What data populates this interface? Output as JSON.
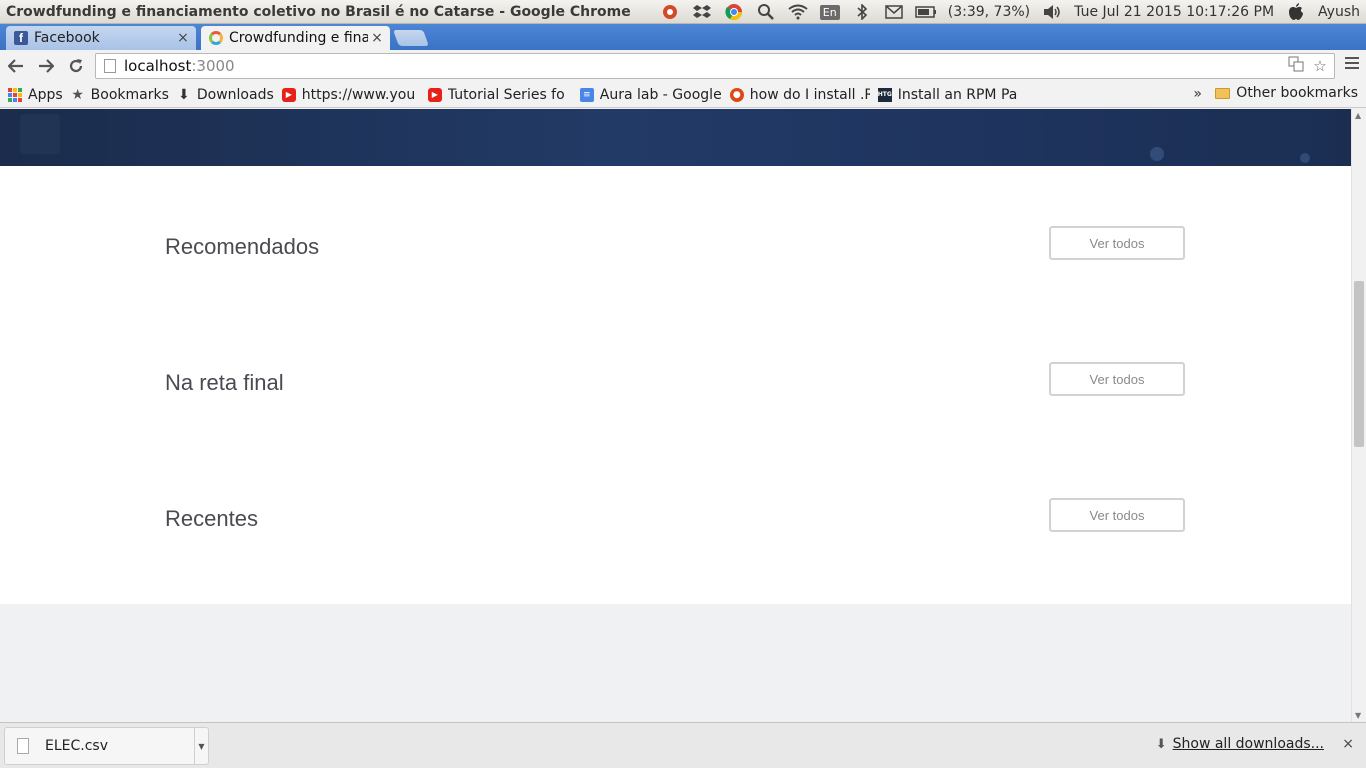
{
  "os": {
    "window_title": "Crowdfunding e financiamento coletivo no Brasil é no Catarse - Google Chrome",
    "lang": "En",
    "battery": "(3:39, 73%)",
    "datetime": "Tue Jul 21 2015 10:17:26 PM",
    "user": "Ayush"
  },
  "tabs": [
    {
      "label": "Facebook",
      "icon": "facebook-icon",
      "close": "×"
    },
    {
      "label": "Crowdfunding e financiamento",
      "icon": "catarse-icon",
      "close": "×"
    }
  ],
  "toolbar": {
    "url_host": "localhost",
    "url_port": ":3000"
  },
  "bookmarks": {
    "items": [
      {
        "label": "Apps",
        "icon": "apps-icon"
      },
      {
        "label": "Bookmarks",
        "icon": "star-icon"
      },
      {
        "label": "Downloads",
        "icon": "download-icon"
      },
      {
        "label": "https://www.you",
        "icon": "youtube-icon"
      },
      {
        "label": "Tutorial Series fo",
        "icon": "youtube-icon"
      },
      {
        "label": "Aura lab - Google",
        "icon": "google-docs-icon"
      },
      {
        "label": "how do I install .R",
        "icon": "ubuntu-icon"
      },
      {
        "label": "Install an RPM Pa",
        "icon": "htg-icon"
      }
    ],
    "more": "»",
    "other": "Other bookmarks"
  },
  "page": {
    "sections": [
      {
        "title": "Recomendados",
        "button": "Ver todos"
      },
      {
        "title": "Na reta final",
        "button": "Ver todos"
      },
      {
        "title": "Recentes",
        "button": "Ver todos"
      }
    ]
  },
  "downloads": {
    "file_name": "ELEC.csv",
    "show_all": "Show all downloads...",
    "close": "×"
  },
  "colors": {
    "hero": "#1f3560",
    "tabstrip": "#3a72c4",
    "section_title": "#4a4a52",
    "button_border": "#d2d2d2"
  }
}
